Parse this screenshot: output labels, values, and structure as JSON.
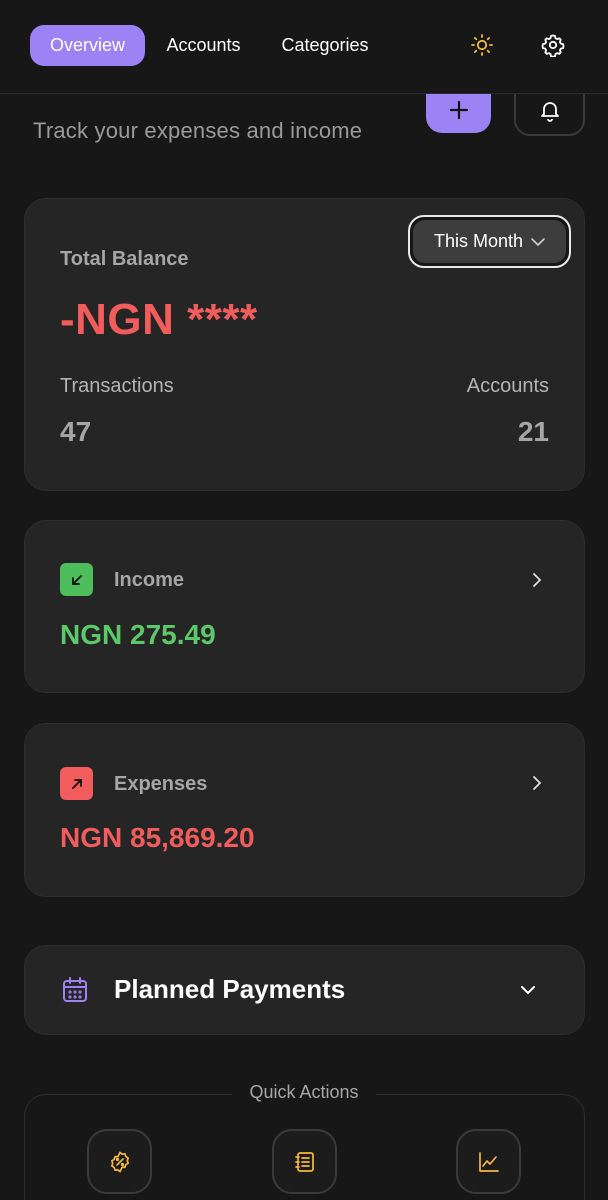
{
  "nav": {
    "tabs": [
      {
        "label": "Overview",
        "active": true
      },
      {
        "label": "Accounts",
        "active": false
      },
      {
        "label": "Categories",
        "active": false
      }
    ],
    "icons": [
      "sun-icon",
      "gear-icon"
    ]
  },
  "header": {
    "subtitle": "Track your expenses and income",
    "add_icon": "plus-icon",
    "notification_icon": "bell-icon"
  },
  "balance": {
    "label": "Total Balance",
    "period": "This Month",
    "amount": "-NGN ****",
    "transactions_label": "Transactions",
    "transactions_value": "47",
    "accounts_label": "Accounts",
    "accounts_value": "21"
  },
  "income": {
    "label": "Income",
    "amount": "NGN 275.49"
  },
  "expenses": {
    "label": "Expenses",
    "amount": "NGN 85,869.20"
  },
  "planned": {
    "title": "Planned Payments"
  },
  "quick_actions": {
    "title": "Quick Actions",
    "icons": [
      "discount-badge-icon",
      "notebook-icon",
      "line-chart-icon"
    ]
  },
  "colors": {
    "accent": "#9b82f5",
    "income": "#5cc86a",
    "expense": "#f25c5c",
    "warning": "#f5b83d"
  }
}
